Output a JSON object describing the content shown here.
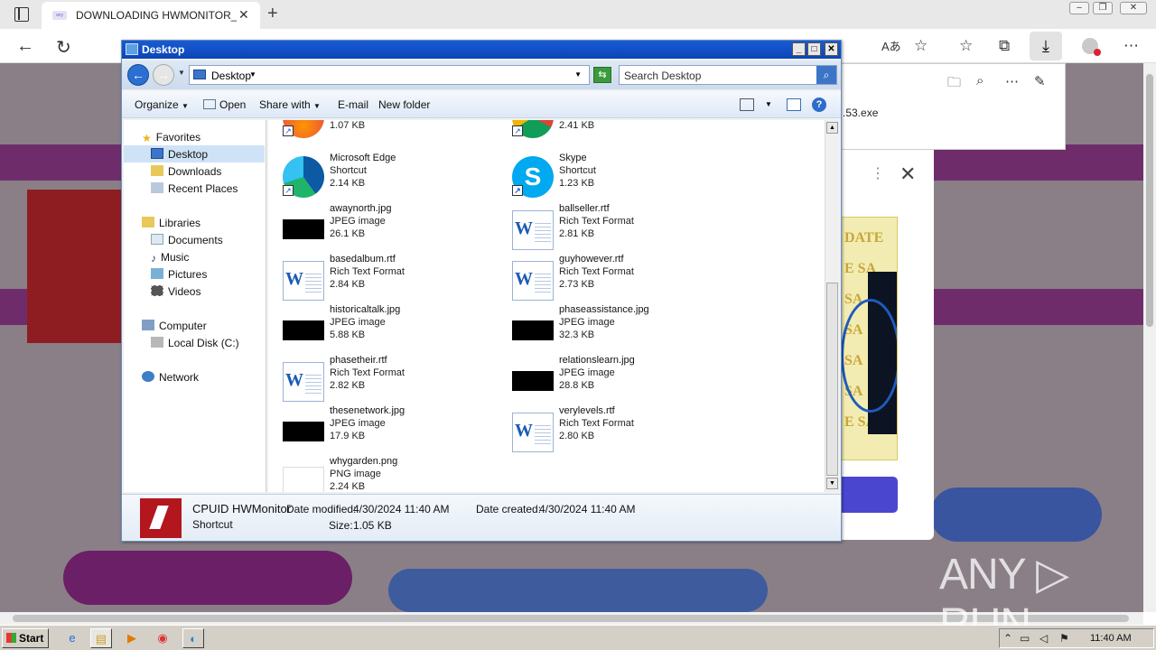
{
  "browser": {
    "tab_title": "DOWNLOADING HWMONITOR_1",
    "tab_close": "✕",
    "new_tab": "+",
    "download_filename": ".53.exe",
    "toolbar_read_aloud": "Aあ",
    "ad_dots": "⋮",
    "ad_close": "✕",
    "ad_text": "DATE\nE SA\nSA\nSA\nSA\nSA\nE SA"
  },
  "explorer": {
    "title": "Desktop",
    "address": "Desktop",
    "search_placeholder": "Search Desktop",
    "commands": {
      "organize": "Organize",
      "open": "Open",
      "share_with": "Share with",
      "email": "E-mail",
      "new_folder": "New folder"
    },
    "nav": {
      "favorites": "Favorites",
      "desktop": "Desktop",
      "downloads": "Downloads",
      "recent_places": "Recent Places",
      "libraries": "Libraries",
      "documents": "Documents",
      "music": "Music",
      "pictures": "Pictures",
      "videos": "Videos",
      "computer": "Computer",
      "local_disk": "Local Disk (C:)",
      "network": "Network"
    },
    "files": [
      {
        "name": "",
        "type": "",
        "size": "1.07 KB",
        "kind": "firefox"
      },
      {
        "name": "",
        "type": "",
        "size": "2.41 KB",
        "kind": "chrome"
      },
      {
        "name": "Microsoft Edge",
        "type": "Shortcut",
        "size": "2.14 KB",
        "kind": "edge"
      },
      {
        "name": "Skype",
        "type": "Shortcut",
        "size": "1.23 KB",
        "kind": "skype"
      },
      {
        "name": "awaynorth.jpg",
        "type": "JPEG image",
        "size": "26.1 KB",
        "kind": "jpg"
      },
      {
        "name": "ballseller.rtf",
        "type": "Rich Text Format",
        "size": "2.81 KB",
        "kind": "rtf"
      },
      {
        "name": "basedalbum.rtf",
        "type": "Rich Text Format",
        "size": "2.84 KB",
        "kind": "rtf"
      },
      {
        "name": "guyhowever.rtf",
        "type": "Rich Text Format",
        "size": "2.73 KB",
        "kind": "rtf"
      },
      {
        "name": "historicaltalk.jpg",
        "type": "JPEG image",
        "size": "5.88 KB",
        "kind": "jpg"
      },
      {
        "name": "phaseassistance.jpg",
        "type": "JPEG image",
        "size": "32.3 KB",
        "kind": "jpg"
      },
      {
        "name": "phasetheir.rtf",
        "type": "Rich Text Format",
        "size": "2.82 KB",
        "kind": "rtf"
      },
      {
        "name": "relationslearn.jpg",
        "type": "JPEG image",
        "size": "28.8 KB",
        "kind": "jpg"
      },
      {
        "name": "thesenetwork.jpg",
        "type": "JPEG image",
        "size": "17.9 KB",
        "kind": "jpg"
      },
      {
        "name": "verylevels.rtf",
        "type": "Rich Text Format",
        "size": "2.80 KB",
        "kind": "rtf"
      },
      {
        "name": "whygarden.png",
        "type": "PNG image",
        "size": "2.24 KB",
        "kind": "png"
      }
    ],
    "details": {
      "name": "CPUID HWMonitor",
      "type": "Shortcut",
      "date_modified_label": "Date modified:",
      "date_modified": "4/30/2024 11:40 AM",
      "date_created_label": "Date created:",
      "date_created": "4/30/2024 11:40 AM",
      "size_label": "Size:",
      "size": "1.05 KB"
    }
  },
  "watermark": "ANY ▷ RUN",
  "taskbar": {
    "start": "Start",
    "clock": "11:40 AM"
  }
}
